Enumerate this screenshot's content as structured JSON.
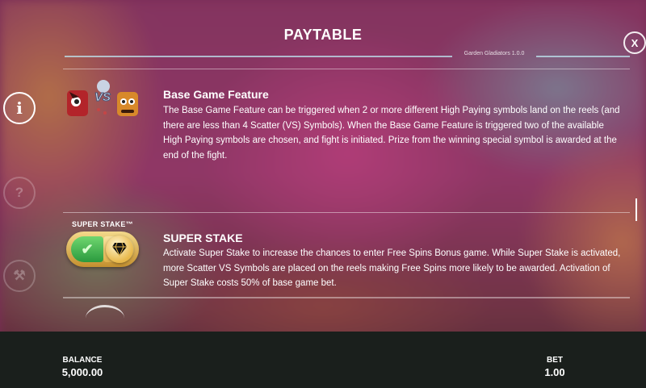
{
  "header": {
    "title": "PAYTABLE",
    "version": "Garden Gladiators 1.0.0",
    "close_label": "X"
  },
  "side_nav": [
    {
      "name": "info",
      "glyph": "i",
      "active": true
    },
    {
      "name": "help",
      "glyph": "?",
      "active": false
    },
    {
      "name": "settings",
      "glyph": "⚒",
      "active": false
    }
  ],
  "sections": {
    "base_game": {
      "title": "Base Game Feature",
      "body": "The Base Game Feature can be triggered when 2 or more different High Paying symbols land on the reels (and there are less than 4 Scatter (VS) Symbols). When the Base Game Feature is triggered two of the available High Paying symbols are chosen, and fight is initiated. Prize from the winning special symbol is awarded at the end of the fight.",
      "icon_text": "VS"
    },
    "super_stake": {
      "label": "SUPER STAKE™",
      "title": "SUPER STAKE",
      "body": "Activate Super Stake to increase the chances to enter Free Spins Bonus game. While Super Stake is activated, more Scatter VS Symbols are placed on the reels making Free Spins more likely to be awarded. Activation of Super Stake costs 50% of base game bet.",
      "toggle_on": true
    }
  },
  "footer": {
    "balance_label": "BALANCE",
    "balance_value": "5,000.00",
    "bet_label": "BET",
    "bet_value": "1.00"
  },
  "colors": {
    "accent_green": "#3fbf4f",
    "gold": "#e0b14a",
    "bar_bg": "#1a1f1c"
  }
}
